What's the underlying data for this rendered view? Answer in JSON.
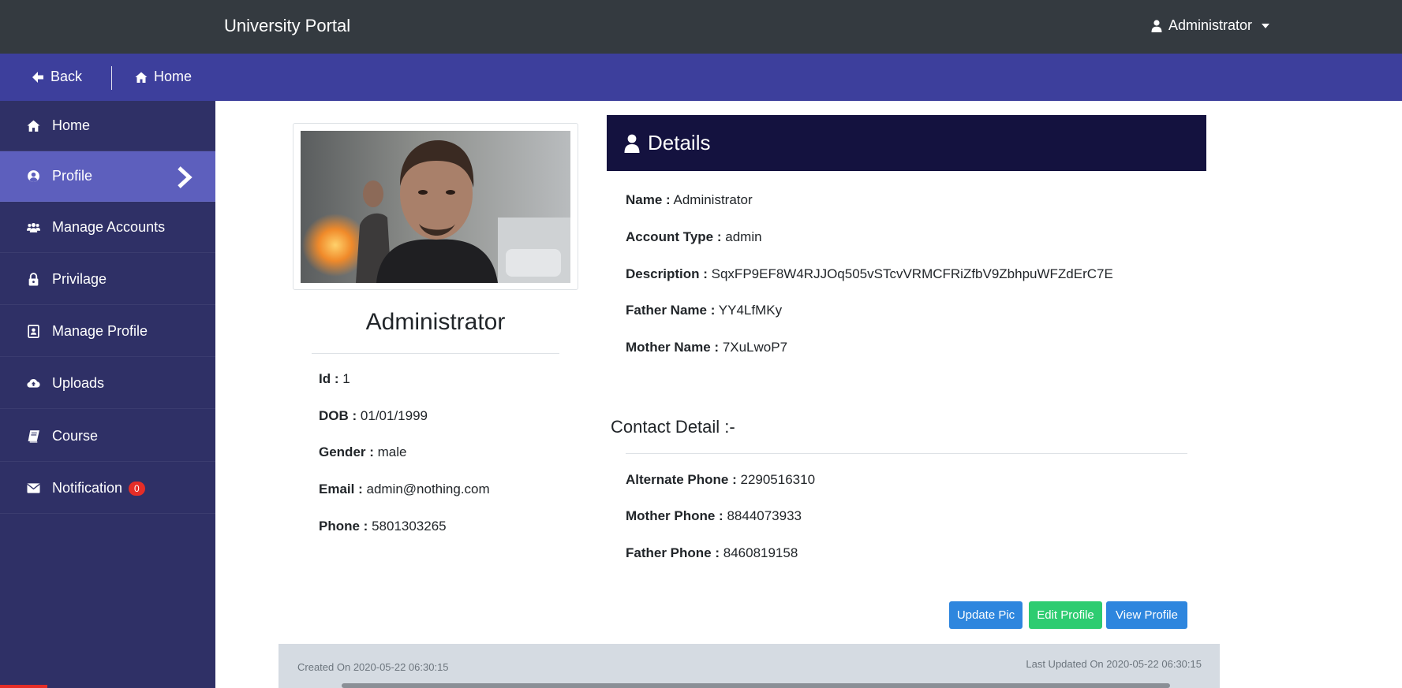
{
  "app": {
    "title": "University Portal"
  },
  "header": {
    "user_label": "Administrator"
  },
  "subnav": {
    "back_label": "Back",
    "home_label": "Home"
  },
  "sidebar": {
    "items": [
      {
        "label": "Home",
        "icon": "home-icon"
      },
      {
        "label": "Profile",
        "icon": "user-circle-icon",
        "active": true
      },
      {
        "label": "Manage Accounts",
        "icon": "users-icon"
      },
      {
        "label": "Privilage",
        "icon": "lock-icon"
      },
      {
        "label": "Manage Profile",
        "icon": "id-card-icon"
      },
      {
        "label": "Uploads",
        "icon": "cloud-upload-icon"
      },
      {
        "label": "Course",
        "icon": "book-icon"
      },
      {
        "label": "Notification",
        "icon": "envelope-icon",
        "badge": "0"
      }
    ]
  },
  "profile": {
    "name": "Administrator",
    "fields": [
      {
        "label": "Id :",
        "value": "1"
      },
      {
        "label": "DOB :",
        "value": "01/01/1999"
      },
      {
        "label": "Gender :",
        "value": "male"
      },
      {
        "label": "Email :",
        "value": "admin@nothing.com"
      },
      {
        "label": "Phone :",
        "value": "5801303265"
      }
    ]
  },
  "details": {
    "title": "Details",
    "fields": [
      {
        "label": "Name :",
        "value": "Administrator"
      },
      {
        "label": "Account Type :",
        "value": "admin"
      },
      {
        "label": "Description :",
        "value": "SqxFP9EF8W4RJJOq505vSTcvVRMCFRiZfbV9ZbhpuWFZdErC7E"
      },
      {
        "label": "Father Name :",
        "value": "YY4LfMKy"
      },
      {
        "label": "Mother Name :",
        "value": "7XuLwoP7"
      }
    ]
  },
  "contact": {
    "title": "Contact Detail :-",
    "fields": [
      {
        "label": "Alternate Phone :",
        "value": "2290516310"
      },
      {
        "label": "Mother Phone :",
        "value": "8844073933"
      },
      {
        "label": "Father Phone :",
        "value": "8460819158"
      }
    ]
  },
  "actions": {
    "update_pic": "Update Pic",
    "edit_profile": "Edit Profile",
    "view_profile": "View Profile"
  },
  "footer": {
    "created": "Created On 2020-05-22 06:30:15",
    "updated": "Last Updated On 2020-05-22 06:30:15"
  },
  "colors": {
    "topbar": "#343a40",
    "subbar": "#3d3f9c",
    "sidebar": "#2f3066",
    "sidebar_active": "#5d5fbd",
    "details_header": "#14123f",
    "btn_blue": "#2e86de",
    "btn_green": "#2ecc71",
    "badge": "#e52d27"
  }
}
